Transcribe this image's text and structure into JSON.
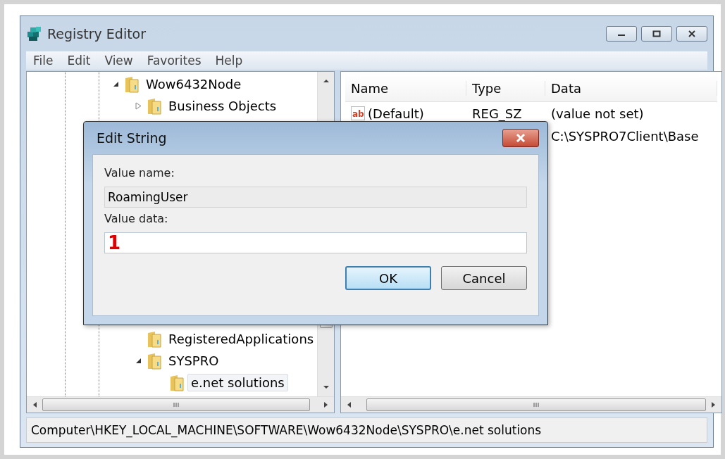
{
  "window": {
    "title": "Registry Editor"
  },
  "menu": [
    "File",
    "Edit",
    "View",
    "Favorites",
    "Help"
  ],
  "tree": {
    "items": [
      {
        "label": "Wow6432Node",
        "expanded": true,
        "selected": false,
        "children": [
          {
            "label": "Business Objects",
            "expanded": false,
            "selected": false
          },
          {
            "label": "RegisteredApplications",
            "selected": false
          },
          {
            "label": "SYSPRO",
            "expanded": true,
            "selected": false,
            "children": [
              {
                "label": "e.net solutions",
                "selected": true
              }
            ]
          }
        ]
      }
    ]
  },
  "list": {
    "columns": [
      "Name",
      "Type",
      "Data"
    ],
    "rows": [
      {
        "icon_label": "ab",
        "name": "(Default)",
        "type": "REG_SZ",
        "data": "(value not set)"
      },
      {
        "data": "C:\\SYSPRO7Client\\Base"
      }
    ]
  },
  "status_bar": "Computer\\HKEY_LOCAL_MACHINE\\SOFTWARE\\Wow6432Node\\SYSPRO\\e.net solutions",
  "dialog": {
    "title": "Edit String",
    "fields": [
      {
        "label": "Value name:",
        "value": "RoamingUser",
        "disabled": true
      },
      {
        "label": "Value data:",
        "value": "1",
        "disabled": false
      }
    ],
    "buttons": [
      {
        "label": "OK",
        "default": true
      },
      {
        "label": "Cancel",
        "default": false
      }
    ]
  }
}
